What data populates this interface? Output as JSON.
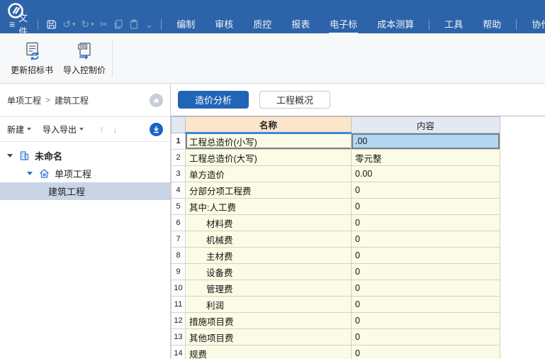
{
  "icons": {
    "hamburger": "≡",
    "undo": "↺",
    "redo": "↻",
    "cut": "✂",
    "caret_down": "▾",
    "chevron_down_small": "⌄",
    "arrow_up": "↑",
    "arrow_down": "↓"
  },
  "topbar": {
    "file_label": "文件",
    "menus": [
      {
        "id": "compile",
        "label": "编制"
      },
      {
        "id": "review",
        "label": "审核"
      },
      {
        "id": "quality-control",
        "label": "质控"
      },
      {
        "id": "reports",
        "label": "报表"
      },
      {
        "id": "e-bid",
        "label": "电子标",
        "active": true
      },
      {
        "id": "cost-estimate",
        "label": "成本测算"
      },
      {
        "id": "tools",
        "label": "工具",
        "sep_before": true
      },
      {
        "id": "help",
        "label": "帮助"
      },
      {
        "id": "collaborate",
        "label": "协作",
        "sep_before": true
      }
    ]
  },
  "ribbon": {
    "buttons": [
      {
        "id": "update-bid",
        "label": "更新招标书",
        "icon": "refresh-doc-icon"
      },
      {
        "id": "import-control-price",
        "label": "导入控制价",
        "icon": "xml-import-icon"
      }
    ]
  },
  "left_panel": {
    "breadcrumb": {
      "parts": [
        "单项工程",
        "建筑工程"
      ],
      "separator": ">"
    },
    "toolbar": {
      "new_label": "新建",
      "import_export_label": "导入导出"
    },
    "tree": [
      {
        "id": "project-root",
        "label": "未命名",
        "level": 0,
        "icon": "building",
        "expander": "dark",
        "bold": true
      },
      {
        "id": "single-project",
        "label": "单项工程",
        "level": 1,
        "icon": "home",
        "expander": "blue"
      },
      {
        "id": "building-project",
        "label": "建筑工程",
        "level": 2,
        "selected": true
      }
    ]
  },
  "tabs": [
    {
      "id": "cost-analysis",
      "label": "造价分析",
      "active": true
    },
    {
      "id": "project-overview",
      "label": "工程概况",
      "active": false
    }
  ],
  "table": {
    "columns": [
      "名称",
      "内容"
    ],
    "rows": [
      {
        "num": 1,
        "name": "工程总造价(小写)",
        "value": ".00",
        "selected": true
      },
      {
        "num": 2,
        "name": "工程总造价(大写)",
        "value": "零元整"
      },
      {
        "num": 3,
        "name": "单方造价",
        "value": "0.00"
      },
      {
        "num": 4,
        "name": "分部分项工程费",
        "value": "0"
      },
      {
        "num": 5,
        "name": "其中:人工费",
        "value": "0"
      },
      {
        "num": 6,
        "name": "材料费",
        "value": "0",
        "indent": true
      },
      {
        "num": 7,
        "name": "机械费",
        "value": "0",
        "indent": true
      },
      {
        "num": 8,
        "name": "主材费",
        "value": "0",
        "indent": true
      },
      {
        "num": 9,
        "name": "设备费",
        "value": "0",
        "indent": true
      },
      {
        "num": 10,
        "name": "管理费",
        "value": "0",
        "indent": true
      },
      {
        "num": 11,
        "name": "利润",
        "value": "0",
        "indent": true
      },
      {
        "num": 12,
        "name": "措施项目费",
        "value": "0"
      },
      {
        "num": 13,
        "name": "其他项目费",
        "value": "0"
      },
      {
        "num": 14,
        "name": "规费",
        "value": "0"
      }
    ]
  },
  "colors": {
    "topbar_blue": "#2d63a8",
    "accent_blue": "#2264b5",
    "header_peach": "#fce5cb",
    "header_gray": "#e3e9f2",
    "cell_yellow": "#fcfbe5",
    "selected_cell_blue": "#b3d6f2",
    "selection_border": "#76808b",
    "column_underline_blue": "#3d87e0",
    "tree_selected": "#c9d5e6"
  }
}
